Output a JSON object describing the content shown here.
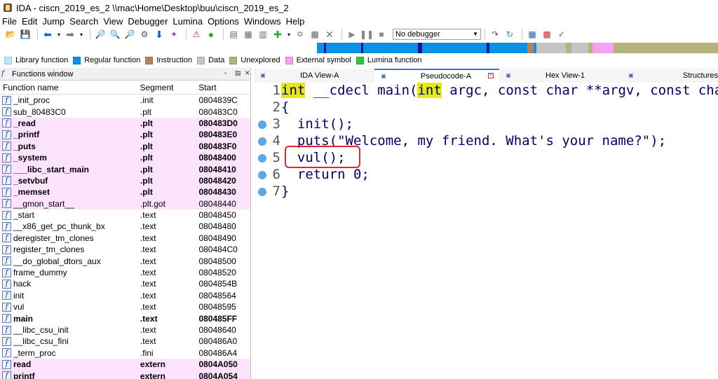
{
  "window": {
    "title": "IDA - ciscn_2019_es_2 \\\\mac\\Home\\Desktop\\buu\\ciscn_2019_es_2"
  },
  "menu": [
    "File",
    "Edit",
    "Jump",
    "Search",
    "View",
    "Debugger",
    "Lumina",
    "Options",
    "Windows",
    "Help"
  ],
  "toolbar": {
    "debugger_select": "No debugger"
  },
  "legend": [
    {
      "label": "Library function",
      "color": "#b7ecf7"
    },
    {
      "label": "Regular function",
      "color": "#0a91e2"
    },
    {
      "label": "Instruction",
      "color": "#b87f5a"
    },
    {
      "label": "Data",
      "color": "#c4c4c4"
    },
    {
      "label": "Unexplored",
      "color": "#b4b47a"
    },
    {
      "label": "External symbol",
      "color": "#f4a0f4"
    },
    {
      "label": "Lumina function",
      "color": "#3ac23a"
    }
  ],
  "functions_window": {
    "title": "Functions window",
    "columns": {
      "name": "Function name",
      "segment": "Segment",
      "start": "Start"
    },
    "rows": [
      {
        "name": "_init_proc",
        "segment": ".init",
        "start": "0804839C",
        "ext": false,
        "bold": false
      },
      {
        "name": "sub_80483C0",
        "segment": ".plt",
        "start": "080483C0",
        "ext": false,
        "bold": false
      },
      {
        "name": "_read",
        "segment": ".plt",
        "start": "080483D0",
        "ext": true,
        "bold": true
      },
      {
        "name": "_printf",
        "segment": ".plt",
        "start": "080483E0",
        "ext": true,
        "bold": true
      },
      {
        "name": "_puts",
        "segment": ".plt",
        "start": "080483F0",
        "ext": true,
        "bold": true
      },
      {
        "name": "_system",
        "segment": ".plt",
        "start": "08048400",
        "ext": true,
        "bold": true
      },
      {
        "name": "___libc_start_main",
        "segment": ".plt",
        "start": "08048410",
        "ext": true,
        "bold": true
      },
      {
        "name": "_setvbuf",
        "segment": ".plt",
        "start": "08048420",
        "ext": true,
        "bold": true
      },
      {
        "name": "_memset",
        "segment": ".plt",
        "start": "08048430",
        "ext": true,
        "bold": true
      },
      {
        "name": "__gmon_start__",
        "segment": ".plt.got",
        "start": "08048440",
        "ext": true,
        "bold": false
      },
      {
        "name": "_start",
        "segment": ".text",
        "start": "08048450",
        "ext": false,
        "bold": false
      },
      {
        "name": "__x86_get_pc_thunk_bx",
        "segment": ".text",
        "start": "08048480",
        "ext": false,
        "bold": false
      },
      {
        "name": "deregister_tm_clones",
        "segment": ".text",
        "start": "08048490",
        "ext": false,
        "bold": false
      },
      {
        "name": "register_tm_clones",
        "segment": ".text",
        "start": "080484C0",
        "ext": false,
        "bold": false
      },
      {
        "name": "__do_global_dtors_aux",
        "segment": ".text",
        "start": "08048500",
        "ext": false,
        "bold": false
      },
      {
        "name": "frame_dummy",
        "segment": ".text",
        "start": "08048520",
        "ext": false,
        "bold": false
      },
      {
        "name": "hack",
        "segment": ".text",
        "start": "0804854B",
        "ext": false,
        "bold": false
      },
      {
        "name": "init",
        "segment": ".text",
        "start": "08048564",
        "ext": false,
        "bold": false
      },
      {
        "name": "vul",
        "segment": ".text",
        "start": "08048595",
        "ext": false,
        "bold": false
      },
      {
        "name": "main",
        "segment": ".text",
        "start": "080485FF",
        "ext": false,
        "bold": true
      },
      {
        "name": "__libc_csu_init",
        "segment": ".text",
        "start": "08048640",
        "ext": false,
        "bold": false
      },
      {
        "name": "__libc_csu_fini",
        "segment": ".text",
        "start": "080486A0",
        "ext": false,
        "bold": false
      },
      {
        "name": "_term_proc",
        "segment": ".fini",
        "start": "080486A4",
        "ext": false,
        "bold": false
      },
      {
        "name": "read",
        "segment": "extern",
        "start": "0804A050",
        "ext": true,
        "bold": true
      },
      {
        "name": "printf",
        "segment": "extern",
        "start": "0804A054",
        "ext": true,
        "bold": true
      }
    ]
  },
  "tabs": [
    {
      "label": "IDA View-A",
      "active": false,
      "closable": false
    },
    {
      "label": "Pseudocode-A",
      "active": true,
      "closable": true
    },
    {
      "label": "Hex View-1",
      "active": false,
      "closable": false
    },
    {
      "label": "Structures",
      "active": false,
      "closable": false
    }
  ],
  "pseudocode": {
    "lines": [
      {
        "num": "1",
        "dot": false,
        "segments": [
          {
            "t": "int",
            "hl": true
          },
          {
            "t": " __cdecl main(",
            "hl": false
          },
          {
            "t": "int",
            "hl": true
          },
          {
            "t": " argc, const char **argv, const char **envp)",
            "hl": false
          }
        ]
      },
      {
        "num": "2",
        "dot": false,
        "segments": [
          {
            "t": "{",
            "hl": false
          }
        ]
      },
      {
        "num": "3",
        "dot": true,
        "segments": [
          {
            "t": "  init();",
            "hl": false
          }
        ]
      },
      {
        "num": "4",
        "dot": true,
        "segments": [
          {
            "t": "  puts(\"Welcome, my friend. What's your name?\");",
            "hl": false
          }
        ]
      },
      {
        "num": "5",
        "dot": true,
        "segments": [
          {
            "t": "  vul();",
            "hl": false
          }
        ]
      },
      {
        "num": "6",
        "dot": true,
        "segments": [
          {
            "t": "  return 0;",
            "hl": false
          }
        ]
      },
      {
        "num": "7",
        "dot": true,
        "segments": [
          {
            "t": "}",
            "hl": false
          }
        ]
      }
    ]
  }
}
